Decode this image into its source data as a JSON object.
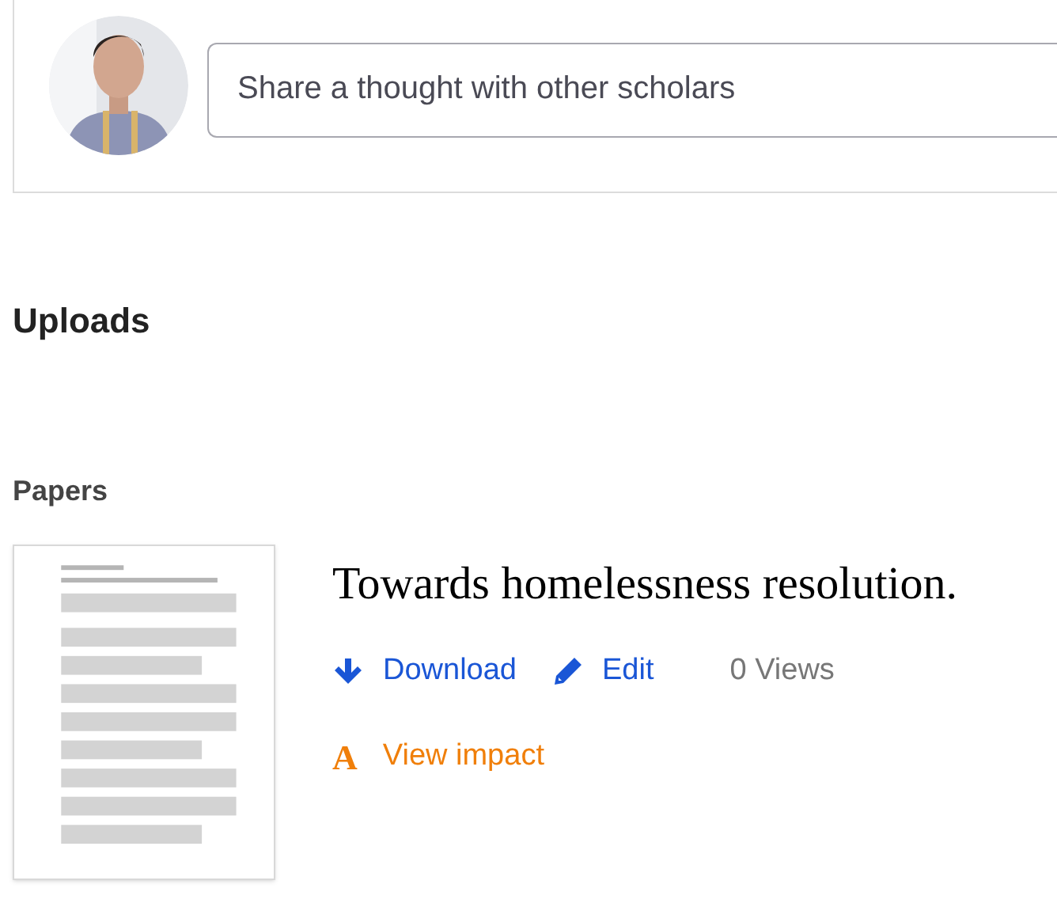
{
  "composer": {
    "placeholder": "Share a thought with other scholars"
  },
  "uploads": {
    "heading": "Uploads"
  },
  "papers": {
    "heading": "Papers",
    "items": [
      {
        "title": "Towards homelessness resolution.",
        "actions": [
          {
            "kind": "download",
            "label": "Download"
          },
          {
            "kind": "edit",
            "label": "Edit"
          }
        ],
        "views": "0 Views",
        "impact": {
          "icon": "A",
          "label": "View impact"
        }
      }
    ]
  }
}
